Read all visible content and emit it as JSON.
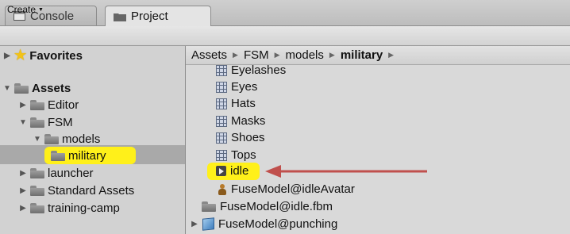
{
  "tabs": [
    {
      "label": "Console",
      "icon": "console-icon"
    },
    {
      "label": "Project",
      "icon": "project-icon"
    }
  ],
  "toolbar": {
    "create_label": "Create"
  },
  "favorites": {
    "label": "Favorites"
  },
  "tree": {
    "root": "Assets",
    "items": [
      "Editor",
      "FSM",
      "models",
      "military",
      "launcher",
      "Standard Assets",
      "training-camp"
    ]
  },
  "breadcrumb": [
    "Assets",
    "FSM",
    "models",
    "military"
  ],
  "assets": {
    "masks": [
      "Eyelashes",
      "Eyes",
      "Hats",
      "Masks",
      "Shoes",
      "Tops"
    ],
    "clip": "idle",
    "avatar": "FuseModel@idleAvatar",
    "fbm_folder": "FuseModel@idle.fbm",
    "model": "FuseModel@punching"
  },
  "colors": {
    "highlight": "#fff01a",
    "arrow": "#c0504d",
    "selection": "#a9a9a9"
  }
}
